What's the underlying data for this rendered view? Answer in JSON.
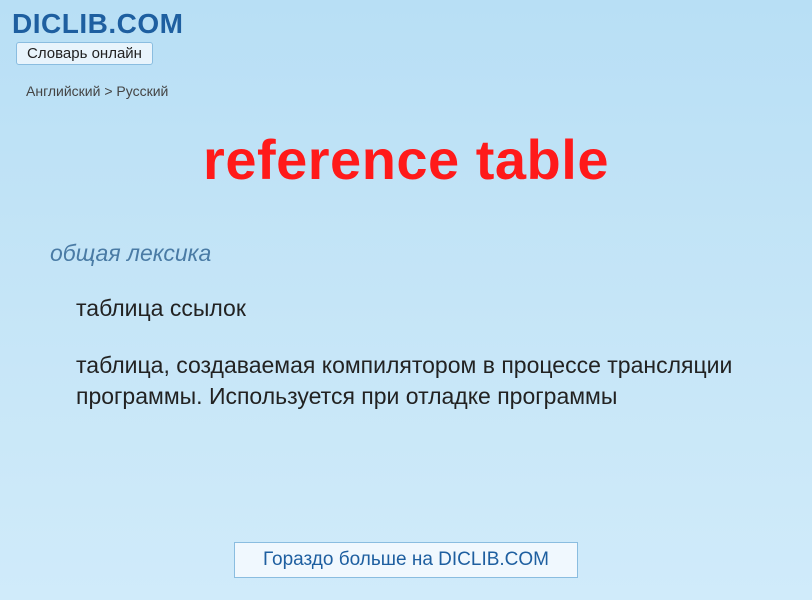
{
  "header": {
    "site_name": "DICLIB.COM",
    "subtitle": "Словарь онлайн"
  },
  "breadcrumb": "Английский > Русский",
  "term": "reference table",
  "entry": {
    "category": "общая лексика",
    "short_def": "таблица ссылок",
    "long_def": "таблица, создаваемая компилятором в процессе трансляции программы. Используется при отладке программы"
  },
  "footer": {
    "more_link": "Гораздо больше на DICLIB.COM"
  }
}
